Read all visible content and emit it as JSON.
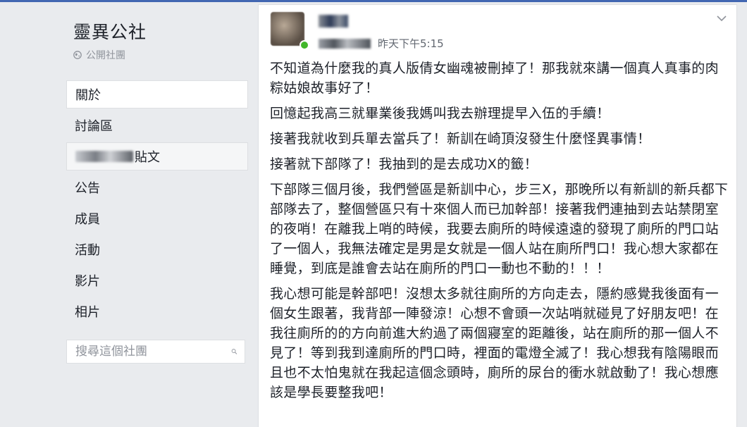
{
  "group": {
    "name": "靈異公社",
    "privacy": "公開社團"
  },
  "nav": {
    "items": [
      {
        "label": "關於"
      },
      {
        "label": "討論區"
      },
      {
        "label": "貼文"
      },
      {
        "label": "公告"
      },
      {
        "label": "成員"
      },
      {
        "label": "活動"
      },
      {
        "label": "影片"
      },
      {
        "label": "相片"
      }
    ]
  },
  "search": {
    "placeholder": "搜尋這個社團"
  },
  "post": {
    "timestamp": "昨天下午5:15",
    "paragraphs": [
      "不知道為什麼我的真人版倩女幽魂被刪掉了！那我就來講一個真人真事的肉粽姑娘故事好了！",
      "回憶起我高三就畢業後我媽叫我去辦理提早入伍的手續！",
      "接著我就收到兵單去當兵了！新訓在崎頂沒發生什麼怪異事情！",
      "接著就下部隊了！我抽到的是去成功X的籤！",
      "下部隊三個月後，我們營區是新訓中心，步三X，那晚所以有新訓的新兵都下部隊去了，整個營區只有十來個人而已加幹部！接著我們連抽到去站禁閉室的夜哨！在離我上哨的時候，我要去廁所的時候遠遠的發現了廁所的門口站了一個人，我無法確定是男是女就是一個人站在廁所門口！我心想大家都在睡覺，到底是誰會去站在廁所的門口一動也不動的！！！",
      "我心想可能是幹部吧！沒想太多就往廁所的方向走去，隱約感覺我後面有一個女生跟著，我背部一陣發涼！心想不會頭一次站哨就碰見了好朋友吧！在我往廁所的的方向前進大約過了兩個寢室的距離後，站在廁所的那一個人不見了！等到我到達廁所的門口時，裡面的電燈全滅了！我心想我有陰陽眼而且也不太怕鬼就在我起這個念頭時，廁所的尿台的衝水就啟動了！我心想應該是學長要整我吧！"
    ]
  },
  "colors": {
    "background": "#e9ebee",
    "text": "#1d2129",
    "muted": "#90949c",
    "online": "#42b72a"
  }
}
